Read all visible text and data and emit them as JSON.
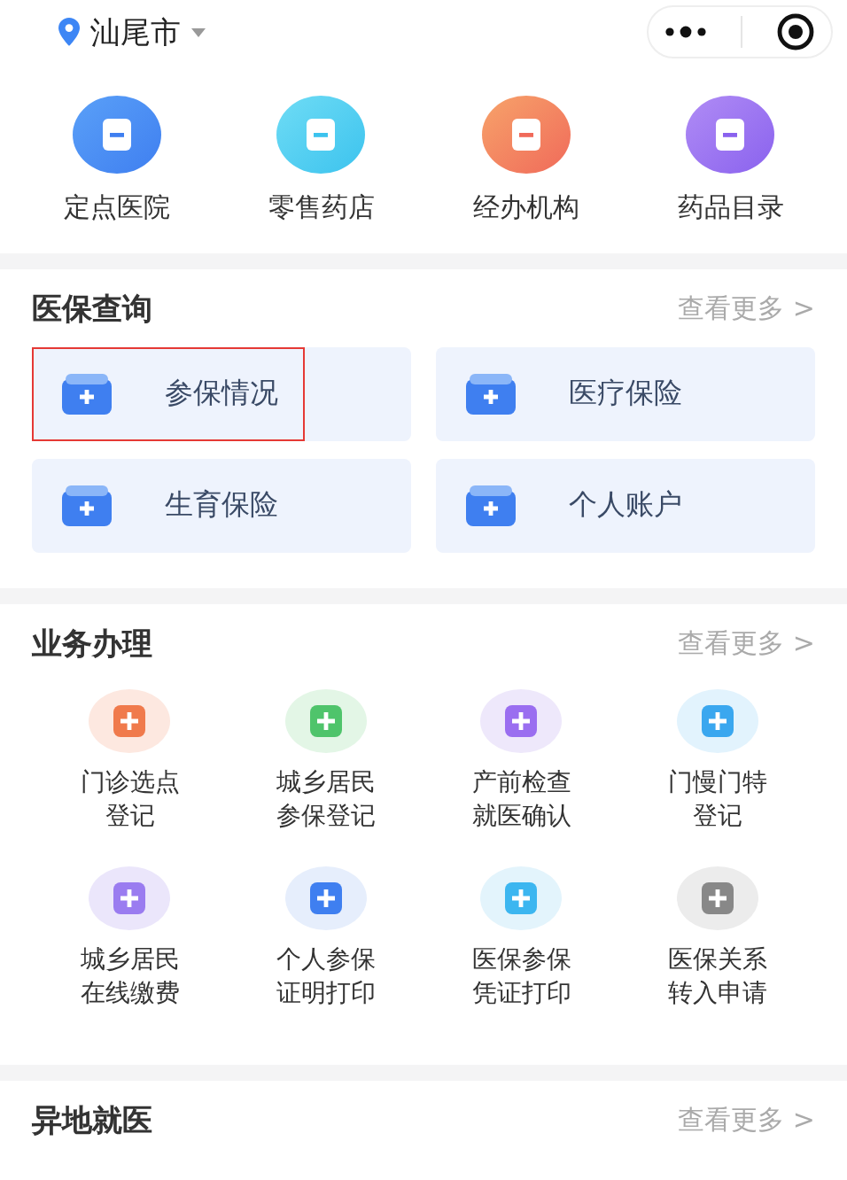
{
  "location": {
    "city": "汕尾市"
  },
  "quick_links": [
    {
      "label": "定点医院"
    },
    {
      "label": "零售药店"
    },
    {
      "label": "经办机构"
    },
    {
      "label": "药品目录"
    }
  ],
  "sections": [
    {
      "kind": "cards",
      "title": "医保查询",
      "more": "查看更多 >",
      "items": [
        {
          "label": "参保情况",
          "highlighted": true
        },
        {
          "label": "医疗保险",
          "highlighted": false
        },
        {
          "label": "生育保险",
          "highlighted": false
        },
        {
          "label": "个人账户",
          "highlighted": false
        }
      ]
    },
    {
      "kind": "grid",
      "title": "业务办理",
      "more": "查看更多 >",
      "items": [
        {
          "lines": [
            "门诊选点",
            "登记"
          ]
        },
        {
          "lines": [
            "城乡居民",
            "参保登记"
          ]
        },
        {
          "lines": [
            "产前检查",
            "就医确认"
          ]
        },
        {
          "lines": [
            "门慢门特",
            "登记"
          ]
        },
        {
          "lines": [
            "城乡居民",
            "在线缴费"
          ]
        },
        {
          "lines": [
            "个人参保",
            "证明打印"
          ]
        },
        {
          "lines": [
            "医保参保",
            "凭证打印"
          ]
        },
        {
          "lines": [
            "医保关系",
            "转入申请"
          ]
        }
      ]
    },
    {
      "kind": "header",
      "title": "异地就医",
      "more": "查看更多 >"
    }
  ]
}
